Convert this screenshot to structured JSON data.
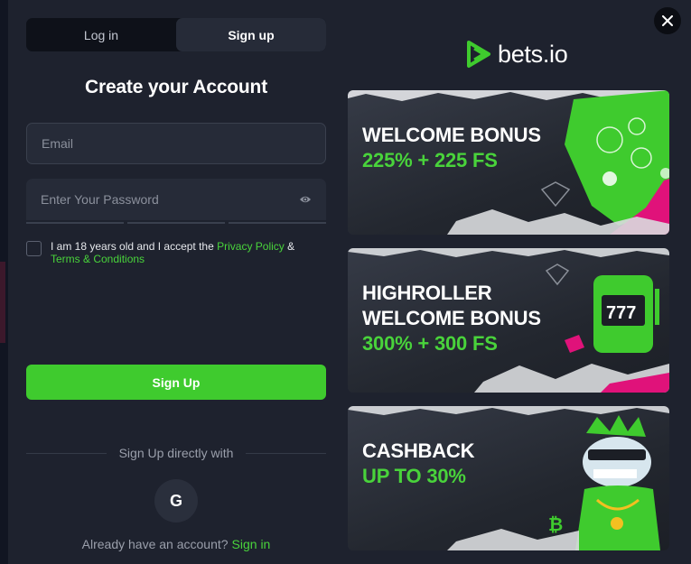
{
  "tabs": [
    {
      "label": "Log in",
      "active": false
    },
    {
      "label": "Sign up",
      "active": true
    }
  ],
  "form": {
    "title": "Create your Account",
    "email_placeholder": "Email",
    "password_placeholder": "Enter Your Password",
    "terms_prefix": "I am 18 years old and I accept the",
    "privacy_link": "Privacy Policy",
    "terms_amp": "&",
    "terms_link": "Terms & Conditions",
    "submit_label": "Sign Up",
    "divider_text": "Sign Up directly with",
    "google_letter": "G",
    "already_text": "Already have an account?",
    "signin_link": "Sign in"
  },
  "brand": {
    "name": "bets.io",
    "accent": "#3fcb2e"
  },
  "banners": [
    {
      "line1": "WELCOME BONUS",
      "line2": "225% + 225 FS"
    },
    {
      "line1": "HIGHROLLER",
      "line1b": "WELCOME BONUS",
      "line2": "300% + 300 FS"
    },
    {
      "line1": "CASHBACK",
      "line2": "UP TO 30%"
    }
  ],
  "icons": {
    "close": "close-icon",
    "eye": "eye-icon",
    "google": "google-icon",
    "logo": "bets-logo-icon"
  }
}
